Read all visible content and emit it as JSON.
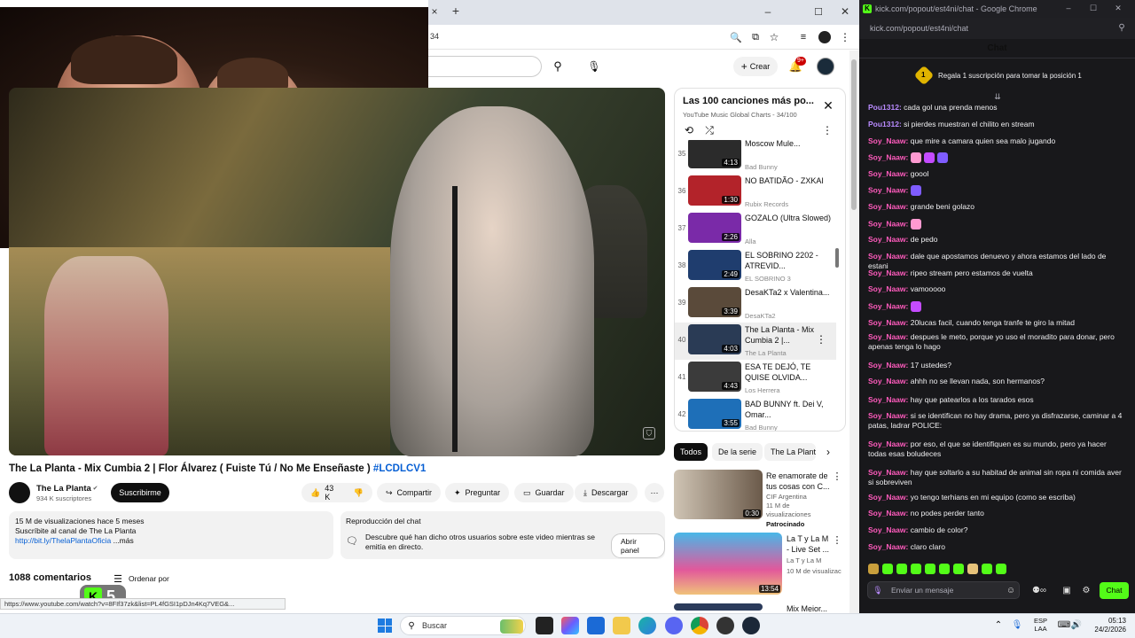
{
  "browser": {
    "url_fragment": "34",
    "new_tab": "+",
    "close_tab": "×",
    "min": "–",
    "max": "☐",
    "close": "✕"
  },
  "youtube": {
    "create_label": "Crear",
    "notif_count": "9+",
    "video_title": "The La Planta - Mix Cumbia 2 | Flor Álvarez ( Fuiste Tú / No Me Enseñaste )",
    "hashtag": "#LCDLCV1",
    "channel_name": "The La Planta",
    "subscribers": "934 K suscriptores",
    "subscribe_label": "Suscribirme",
    "likes": "43 K",
    "share_label": "Compartir",
    "ask_label": "Preguntar",
    "save_label": "Guardar",
    "download_label": "Descargar",
    "desc_views": "15 M de visualizaciones  hace 5 meses",
    "desc_line2": "Suscríbite al canal de The La Planta",
    "desc_link": "http://bit.ly/ThelaPlantaOficia",
    "desc_more": "...más",
    "chat_replay_title": "Reproducción del chat",
    "chat_replay_text": "Descubre qué han dicho otros usuarios sobre este video mientras se emitía en directo.",
    "open_panel": "Abrir panel",
    "comments_count": "1088 comentarios",
    "sort_label": "Ordenar por",
    "status_url": "https://www.youtube.com/watch?v=8FIf37zk&list=PL4fGSI1pDJn4Kq7VEG&...",
    "kick_badge": "5"
  },
  "playlist": {
    "title": "Las 100 canciones más po...",
    "subtitle": "YouTube Music Global Charts - 34/100",
    "items": [
      {
        "idx": "35",
        "title": "Moscow Mule...",
        "channel": "Bad Bunny",
        "duration": "4:13",
        "color": "#2b2b2b"
      },
      {
        "idx": "36",
        "title": "NO BATIDÃO - ZXKAI",
        "channel": "Rubix Records",
        "duration": "1:30",
        "color": "#b3232a"
      },
      {
        "idx": "37",
        "title": "GOZALO (Ultra Slowed)",
        "channel": "Alla",
        "duration": "2:26",
        "color": "#7a2aa8"
      },
      {
        "idx": "38",
        "title": "EL SOBRINO 2202 - ATREVID...",
        "channel": "EL SOBRINO 3",
        "duration": "2:49",
        "color": "#1f3d6e"
      },
      {
        "idx": "39",
        "title": "DesaKTa2 x Valentina...",
        "channel": "DesaKTa2",
        "duration": "3:39",
        "color": "#5a4a3a"
      },
      {
        "idx": "40",
        "title": "The La Planta - Mix Cumbia 2 |...",
        "channel": "The La Planta",
        "duration": "4:03",
        "color": "#2a3b55"
      },
      {
        "idx": "41",
        "title": "ESA TE DEJÓ, TE QUISE OLVIDA...",
        "channel": "Los Herrera",
        "duration": "4:43",
        "color": "#3b3b3b"
      },
      {
        "idx": "42",
        "title": "BAD BUNNY ft. Dei V, Omar...",
        "channel": "Bad Bunny",
        "duration": "3:55",
        "color": "#1e6fb8"
      }
    ]
  },
  "chips": [
    "Todos",
    "De la serie",
    "The La Planta"
  ],
  "recs": [
    {
      "title": "Re enamorate de tus cosas con C...",
      "meta1": "CIF Argentina",
      "meta2": "11 M de visualizaciones",
      "meta3": "Patrocinado",
      "duration": "0:30"
    },
    {
      "title": "La T y La M - Live Set ...",
      "meta1": "La T y La M",
      "meta2": "10 M de visualizac",
      "meta3": "",
      "duration": "13:54"
    },
    {
      "title": "Mix Mejor...",
      "meta1": "",
      "meta2": "",
      "meta3": "",
      "duration": ""
    }
  ],
  "chat": {
    "window_title": "kick.com/popout/est4ni/chat - Google Chrome",
    "url": "kick.com/popout/est4ni/chat",
    "header": "Chat",
    "gift_text": "Regala 1 suscripción para tomar la posición 1",
    "messages": [
      {
        "user": "Pou1312",
        "text": "cada gol una prenda menos",
        "style": "user2"
      },
      {
        "user": "Pou1312",
        "text": "si pierdes muestran el chilito en stream",
        "style": "user2"
      },
      {
        "user": "Soy_Naaw",
        "text": "que mire a camara quien sea malo jugando",
        "style": "user"
      },
      {
        "user": "Soy_Naaw",
        "text": "",
        "style": "user",
        "emotes": 3
      },
      {
        "user": "Soy_Naaw",
        "text": "goool",
        "style": "user"
      },
      {
        "user": "Soy_Naaw",
        "text": "",
        "style": "user",
        "emotes": 1
      },
      {
        "user": "Soy_Naaw",
        "text": "grande beni golazo",
        "style": "user"
      },
      {
        "user": "Soy_Naaw",
        "text": "",
        "style": "user",
        "emotes": 1
      },
      {
        "user": "Soy_Naaw",
        "text": "de pedo",
        "style": "user"
      },
      {
        "user": "Soy_Naaw",
        "text": "dale que apostamos denuevo y ahora estamos del lado de estani",
        "style": "user"
      },
      {
        "user": "Soy_Naaw",
        "text": "ripeo stream pero estamos de vuelta",
        "style": "user"
      },
      {
        "user": "Soy_Naaw",
        "text": "vamooooo",
        "style": "user"
      },
      {
        "user": "Soy_Naaw",
        "text": "",
        "style": "user",
        "emotes": 1
      },
      {
        "user": "Soy_Naaw",
        "text": "20lucas facil, cuando tenga tranfe te giro la mitad",
        "style": "user"
      },
      {
        "user": "Soy_Naaw",
        "text": "despues le meto, porque yo uso el moradito para donar, pero apenas tenga lo hago",
        "style": "user"
      },
      {
        "user": "Soy_Naaw",
        "text": "17 ustedes?",
        "style": "user"
      },
      {
        "user": "Soy_Naaw",
        "text": "ahhh no se llevan nada, son hermanos?",
        "style": "user"
      },
      {
        "user": "Soy_Naaw",
        "text": "hay que patearlos a los tarados esos",
        "style": "user"
      },
      {
        "user": "Soy_Naaw",
        "text": "si se identifican no hay drama, pero ya disfrazarse, caminar a 4 patas, ladrar  POLICE:",
        "style": "user"
      },
      {
        "user": "Soy_Naaw",
        "text": "por eso, el que se identifiquen es su mundo, pero ya hacer todas esas boludeces",
        "style": "user"
      },
      {
        "user": "Soy_Naaw",
        "text": "hay que soltarlo a su habitad de animal sin ropa ni comida aver si sobreviven",
        "style": "user"
      },
      {
        "user": "Soy_Naaw",
        "text": "yo tengo terhians en mi equipo  (como se escriba)",
        "style": "user"
      },
      {
        "user": "Soy_Naaw",
        "text": "no podes perder tanto",
        "style": "user"
      },
      {
        "user": "Soy_Naaw",
        "text": "cambio de color?",
        "style": "user"
      },
      {
        "user": "Soy_Naaw",
        "text": "claro claro",
        "style": "user"
      }
    ],
    "input_placeholder": "Enviar un mensaje",
    "send_label": "Chat"
  },
  "taskbar": {
    "search_placeholder": "Buscar",
    "lang": "ESP",
    "lang2": "LAA",
    "time": "05:13",
    "date": "24/2/2026"
  },
  "colors": {
    "kick_green": "#53fc18",
    "yt_red": "#ff0000",
    "chat_bg": "#18181b"
  }
}
